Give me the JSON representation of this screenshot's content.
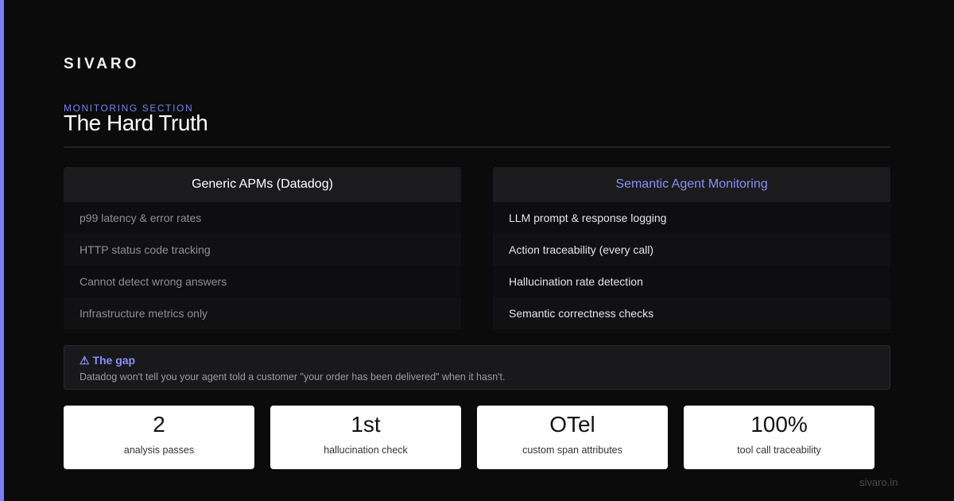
{
  "brand": "SIVARO",
  "section_label": "MONITORING SECTION",
  "title": "The Hard Truth",
  "comparison": {
    "left": {
      "heading": "Generic APMs (Datadog)",
      "items": [
        "p99 latency & error rates",
        "HTTP status code tracking",
        "Cannot detect wrong answers",
        "Infrastructure metrics only"
      ]
    },
    "right": {
      "heading": "Semantic Agent Monitoring",
      "items": [
        "LLM prompt & response logging",
        "Action traceability (every call)",
        "Hallucination rate detection",
        "Semantic correctness checks"
      ]
    }
  },
  "gap": {
    "icon": "warning-icon",
    "title": "⚠ The gap",
    "text": "Datadog won't tell you your agent told a customer \"your order has been delivered\" when it hasn't."
  },
  "stats": [
    {
      "value": "2",
      "label": "analysis passes"
    },
    {
      "value": "1st",
      "label": "hallucination check"
    },
    {
      "value": "OTel",
      "label": "custom span attributes"
    },
    {
      "value": "100%",
      "label": "tool call traceability"
    }
  ],
  "footer": "sivaro.in",
  "colors": {
    "accent": "#7b7ff0",
    "background": "#0b0b0c",
    "highlight_heading": "#8a8ef5"
  }
}
